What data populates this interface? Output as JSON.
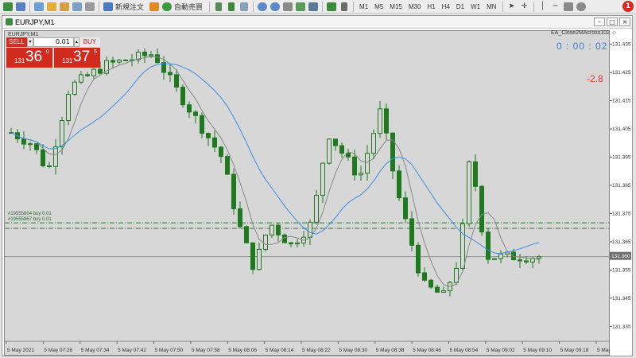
{
  "toolbar": {
    "new_order_label": "新規注文",
    "auto_trade_label": "自動売買",
    "timeframes": [
      "M1",
      "M5",
      "M15",
      "M30",
      "H1",
      "H4",
      "D1",
      "W1",
      "MN"
    ],
    "alert_count": "1"
  },
  "window": {
    "title": "EURJPY,M1",
    "symbol_label": "EURJPY,M1"
  },
  "one_click": {
    "sell_label": "SELL",
    "buy_label": "BUY",
    "lot_value": "0.01",
    "sell_prefix": "131",
    "sell_big": "36",
    "sell_sup": "0",
    "buy_prefix": "131",
    "buy_big": "37",
    "buy_sup": "5"
  },
  "ea_label": "EA_Close2MAcross102 ☺",
  "timer": "0 : 00 : 02",
  "indicator_value": "-2.8",
  "order_lines": [
    {
      "text": "#19555804 buy 0.01"
    },
    {
      "text": "#19555867 buy 0.01"
    }
  ],
  "current_price": "131.360",
  "colors": {
    "bull": "#1f7a1f",
    "bear": "#1f7a1f",
    "ma_fast": "#888888",
    "ma_slow": "#3a8ee6",
    "price_line": "#8c8c8c",
    "order_line": "#2e7d32",
    "sell": "#d42c23",
    "timer": "#3a7bd5",
    "indicator": "#e33a2a"
  },
  "chart_data": {
    "type": "candlestick",
    "yticks": [
      "131.435",
      "131.425",
      "131.415",
      "131.405",
      "131.395",
      "131.385",
      "131.375",
      "131.365",
      "131.355",
      "131.345",
      "131.335"
    ],
    "ylim": [
      131.33,
      131.44
    ],
    "xticks": [
      "5 May 2021",
      "5 May 07:26",
      "5 May 07:34",
      "5 May 07:42",
      "5 May 07:50",
      "5 May 07:58",
      "5 May 08:06",
      "5 May 08:14",
      "5 May 08:22",
      "5 May 08:30",
      "5 May 08:38",
      "5 May 08:46",
      "5 May 08:54",
      "5 May 09:02",
      "5 May 09:10",
      "5 May 09:18",
      "5 May 09:26"
    ],
    "order_prices": [
      131.372,
      131.37
    ],
    "current_price": 131.36
  }
}
